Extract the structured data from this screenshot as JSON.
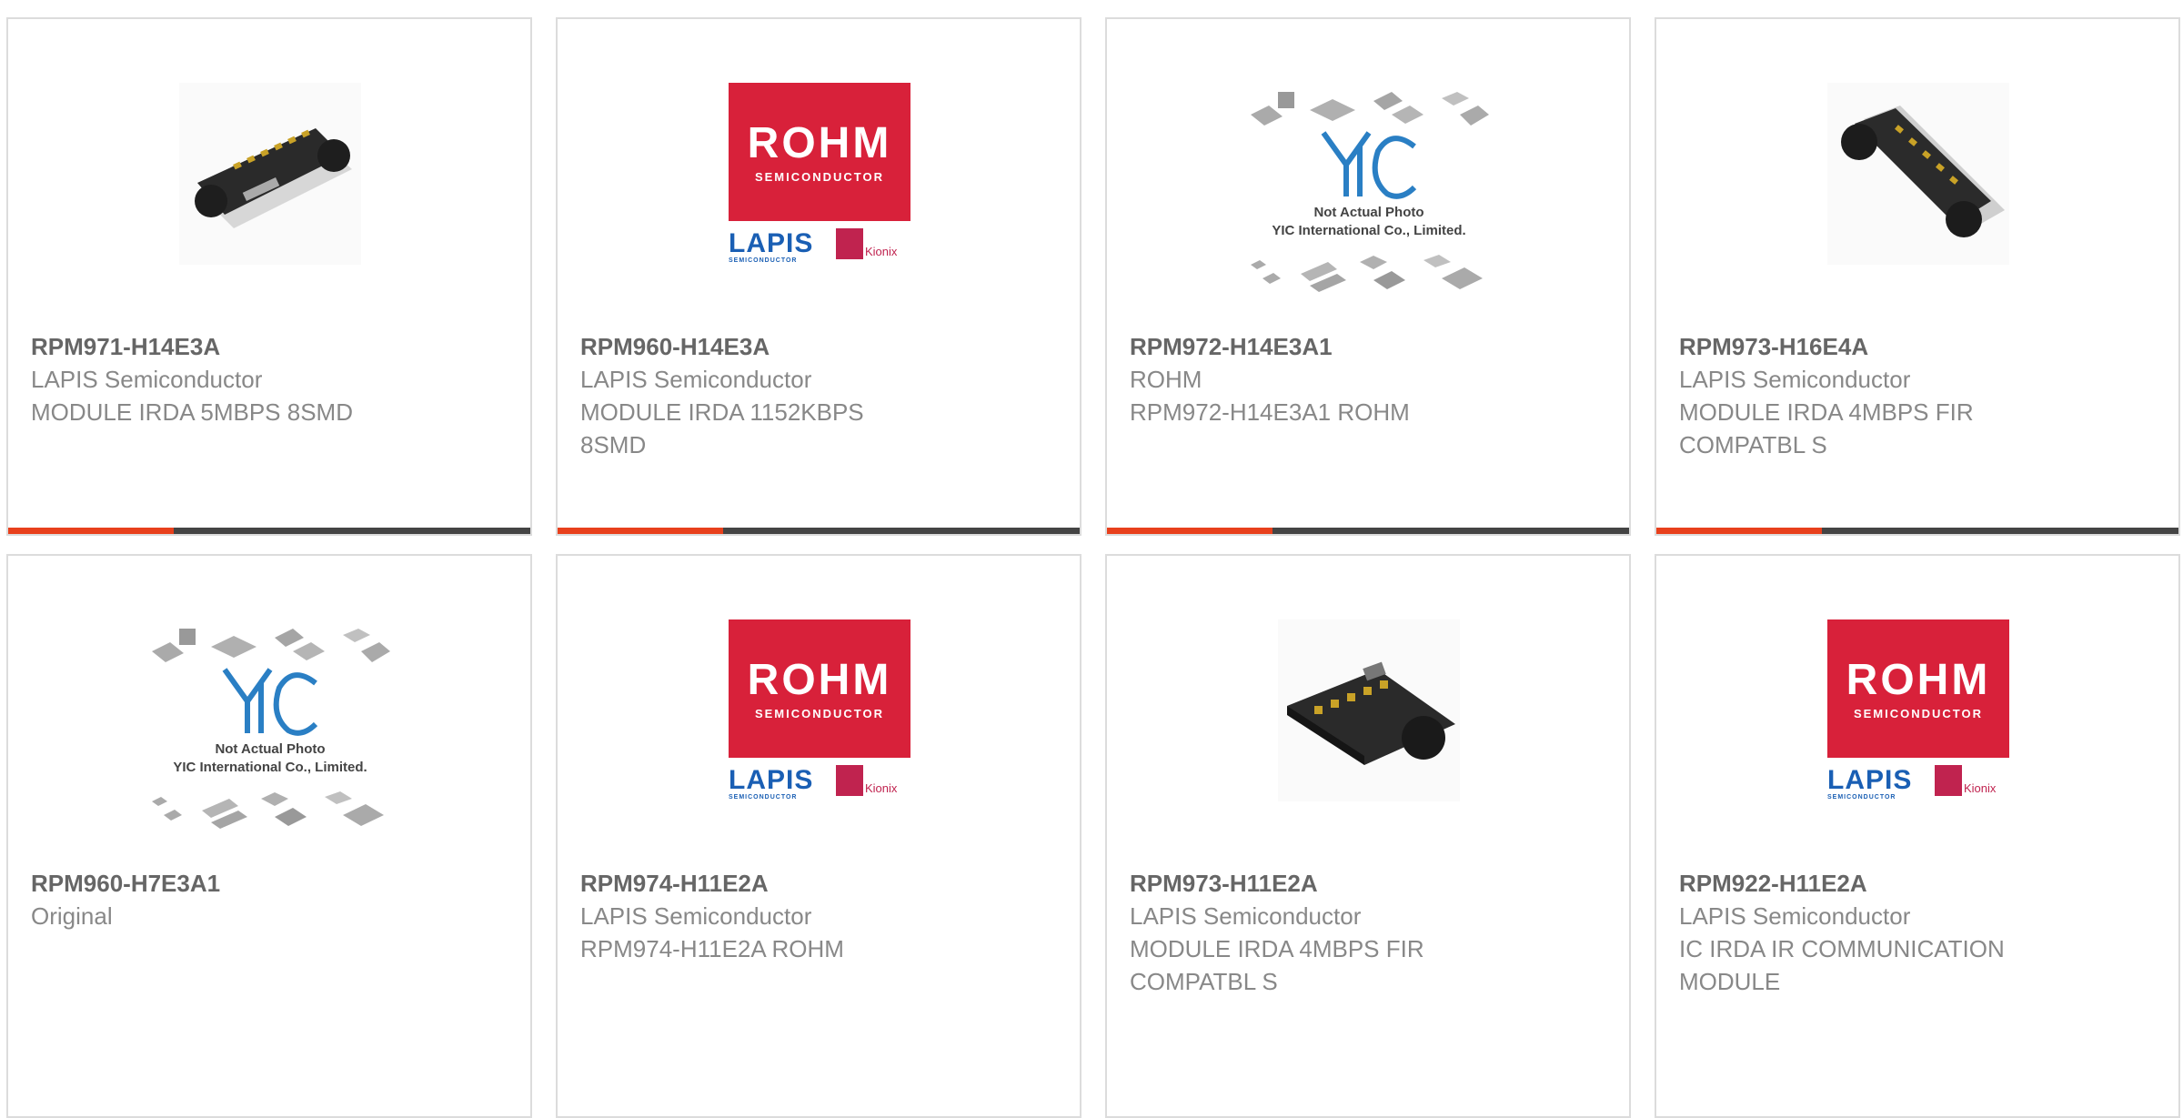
{
  "products": [
    {
      "part_number": "RPM971-H14E3A",
      "manufacturer": "LAPIS Semiconductor",
      "description": "MODULE IRDA 5MBPS 8SMD",
      "image": "ir-module-photo-icon"
    },
    {
      "part_number": "RPM960-H14E3A",
      "manufacturer": "LAPIS Semiconductor",
      "description": "MODULE IRDA 1152KBPS 8SMD",
      "image": "rohm-lapis-logo-icon"
    },
    {
      "part_number": "RPM972-H14E3A1",
      "manufacturer": "ROHM",
      "description": "RPM972-H14E3A1 ROHM",
      "image": "yic-placeholder-icon"
    },
    {
      "part_number": "RPM973-H16E4A",
      "manufacturer": "LAPIS Semiconductor",
      "description": "MODULE IRDA 4MBPS FIR COMPATBL S",
      "image": "ir-module-photo-icon"
    },
    {
      "part_number": "RPM960-H7E3A1",
      "manufacturer": "Original",
      "description": "",
      "image": "yic-placeholder-icon"
    },
    {
      "part_number": "RPM974-H11E2A",
      "manufacturer": "LAPIS Semiconductor",
      "description": "RPM974-H11E2A ROHM",
      "image": "rohm-lapis-logo-icon"
    },
    {
      "part_number": "RPM973-H11E2A",
      "manufacturer": "LAPIS Semiconductor",
      "description": "MODULE IRDA 4MBPS FIR COMPATBL S",
      "image": "ir-module-photo-icon"
    },
    {
      "part_number": "RPM922-H11E2A",
      "manufacturer": "LAPIS Semiconductor",
      "description": "IC IRDA IR COMMUNICATION MODULE",
      "image": "rohm-lapis-logo-icon"
    }
  ],
  "logo_text": {
    "rohm": "ROHM",
    "semiconductor": "SEMICONDUCTOR",
    "lapis": "LAPIS",
    "lapis_sub": "SEMICONDUCTOR",
    "kionix": "Kionix"
  },
  "placeholder_text": {
    "line1": "Not Actual Photo",
    "line2": "YIC International Co., Limited."
  },
  "colors": {
    "accent": "#e8401c",
    "bar": "#444444",
    "rohm_red": "#d8213a",
    "lapis_blue": "#1a5fb4"
  }
}
